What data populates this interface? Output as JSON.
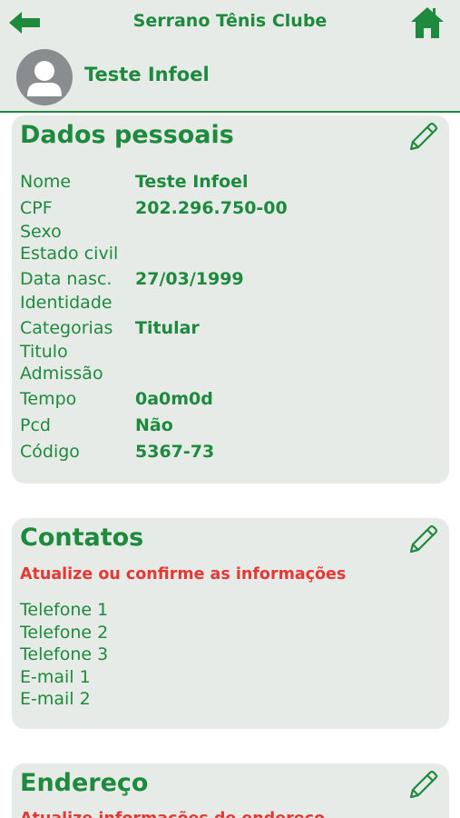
{
  "header": {
    "title": "Serrano Tênis Clube",
    "back_icon": "arrow-left-icon",
    "home_icon": "home-icon",
    "user_name": "Teste Infoel",
    "avatar_icon": "user-avatar-icon"
  },
  "colors": {
    "brand_green": "#1e8a3e",
    "card_bg": "#e7ebe7",
    "warning_red": "#e53935",
    "avatar_gray": "#8a8d8f"
  },
  "personal": {
    "title": "Dados pessoais",
    "edit_icon": "pencil-icon",
    "rows": [
      {
        "label": "Nome",
        "value": "Teste Infoel"
      },
      {
        "label": "CPF",
        "value": "202.296.750-00"
      },
      {
        "label": "Sexo",
        "value": ""
      },
      {
        "label": "Estado civil",
        "value": ""
      },
      {
        "label": "Data nasc.",
        "value": "27/03/1999"
      },
      {
        "label": "Identidade",
        "value": ""
      },
      {
        "label": "Categorias",
        "value": "Titular"
      },
      {
        "label": "Titulo",
        "value": ""
      },
      {
        "label": "Admissão",
        "value": ""
      },
      {
        "label": "Tempo",
        "value": "0a0m0d"
      },
      {
        "label": "Pcd",
        "value": "Não"
      },
      {
        "label": "Código",
        "value": "5367-73"
      }
    ]
  },
  "contacts": {
    "title": "Contatos",
    "edit_icon": "pencil-icon",
    "warning": "Atualize ou confirme as informações",
    "rows": [
      {
        "label": "Telefone 1"
      },
      {
        "label": "Telefone 2"
      },
      {
        "label": "Telefone 3"
      },
      {
        "label": "E-mail 1"
      },
      {
        "label": "E-mail 2"
      }
    ]
  },
  "address": {
    "title": "Endereço",
    "edit_icon": "pencil-icon",
    "warning": "Atualize informações de endereço"
  }
}
